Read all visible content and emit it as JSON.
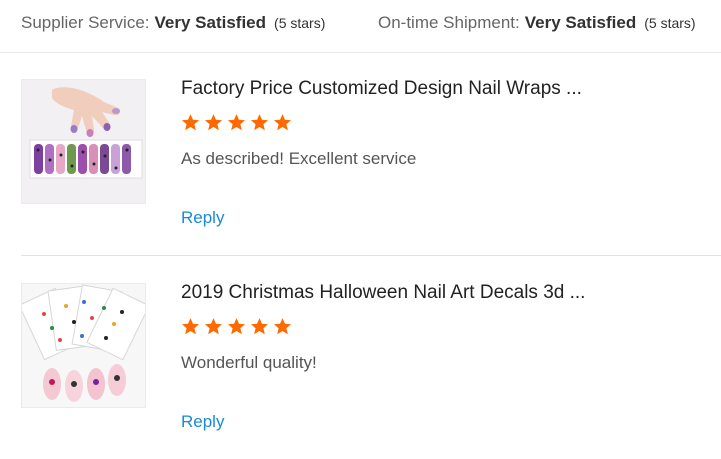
{
  "summary": {
    "supplier_label": "Supplier Service:",
    "supplier_value": "Very Satisfied",
    "supplier_stars": "(5 stars)",
    "shipment_label": "On-time Shipment:",
    "shipment_value": "Very Satisfied",
    "shipment_stars": "(5 stars)"
  },
  "colors": {
    "star": "#ff6a00",
    "link": "#1a8ad6"
  },
  "reviews": [
    {
      "title": "Factory Price Customized Design Nail Wraps ...",
      "rating": 5,
      "comment": "As described! Excellent service",
      "reply_label": "Reply",
      "image_icon": "nail-wraps-product-image"
    },
    {
      "title": "2019 Christmas Halloween Nail Art Decals 3d ...",
      "rating": 5,
      "comment": "Wonderful quality!",
      "reply_label": "Reply",
      "image_icon": "nail-decals-product-image"
    }
  ]
}
